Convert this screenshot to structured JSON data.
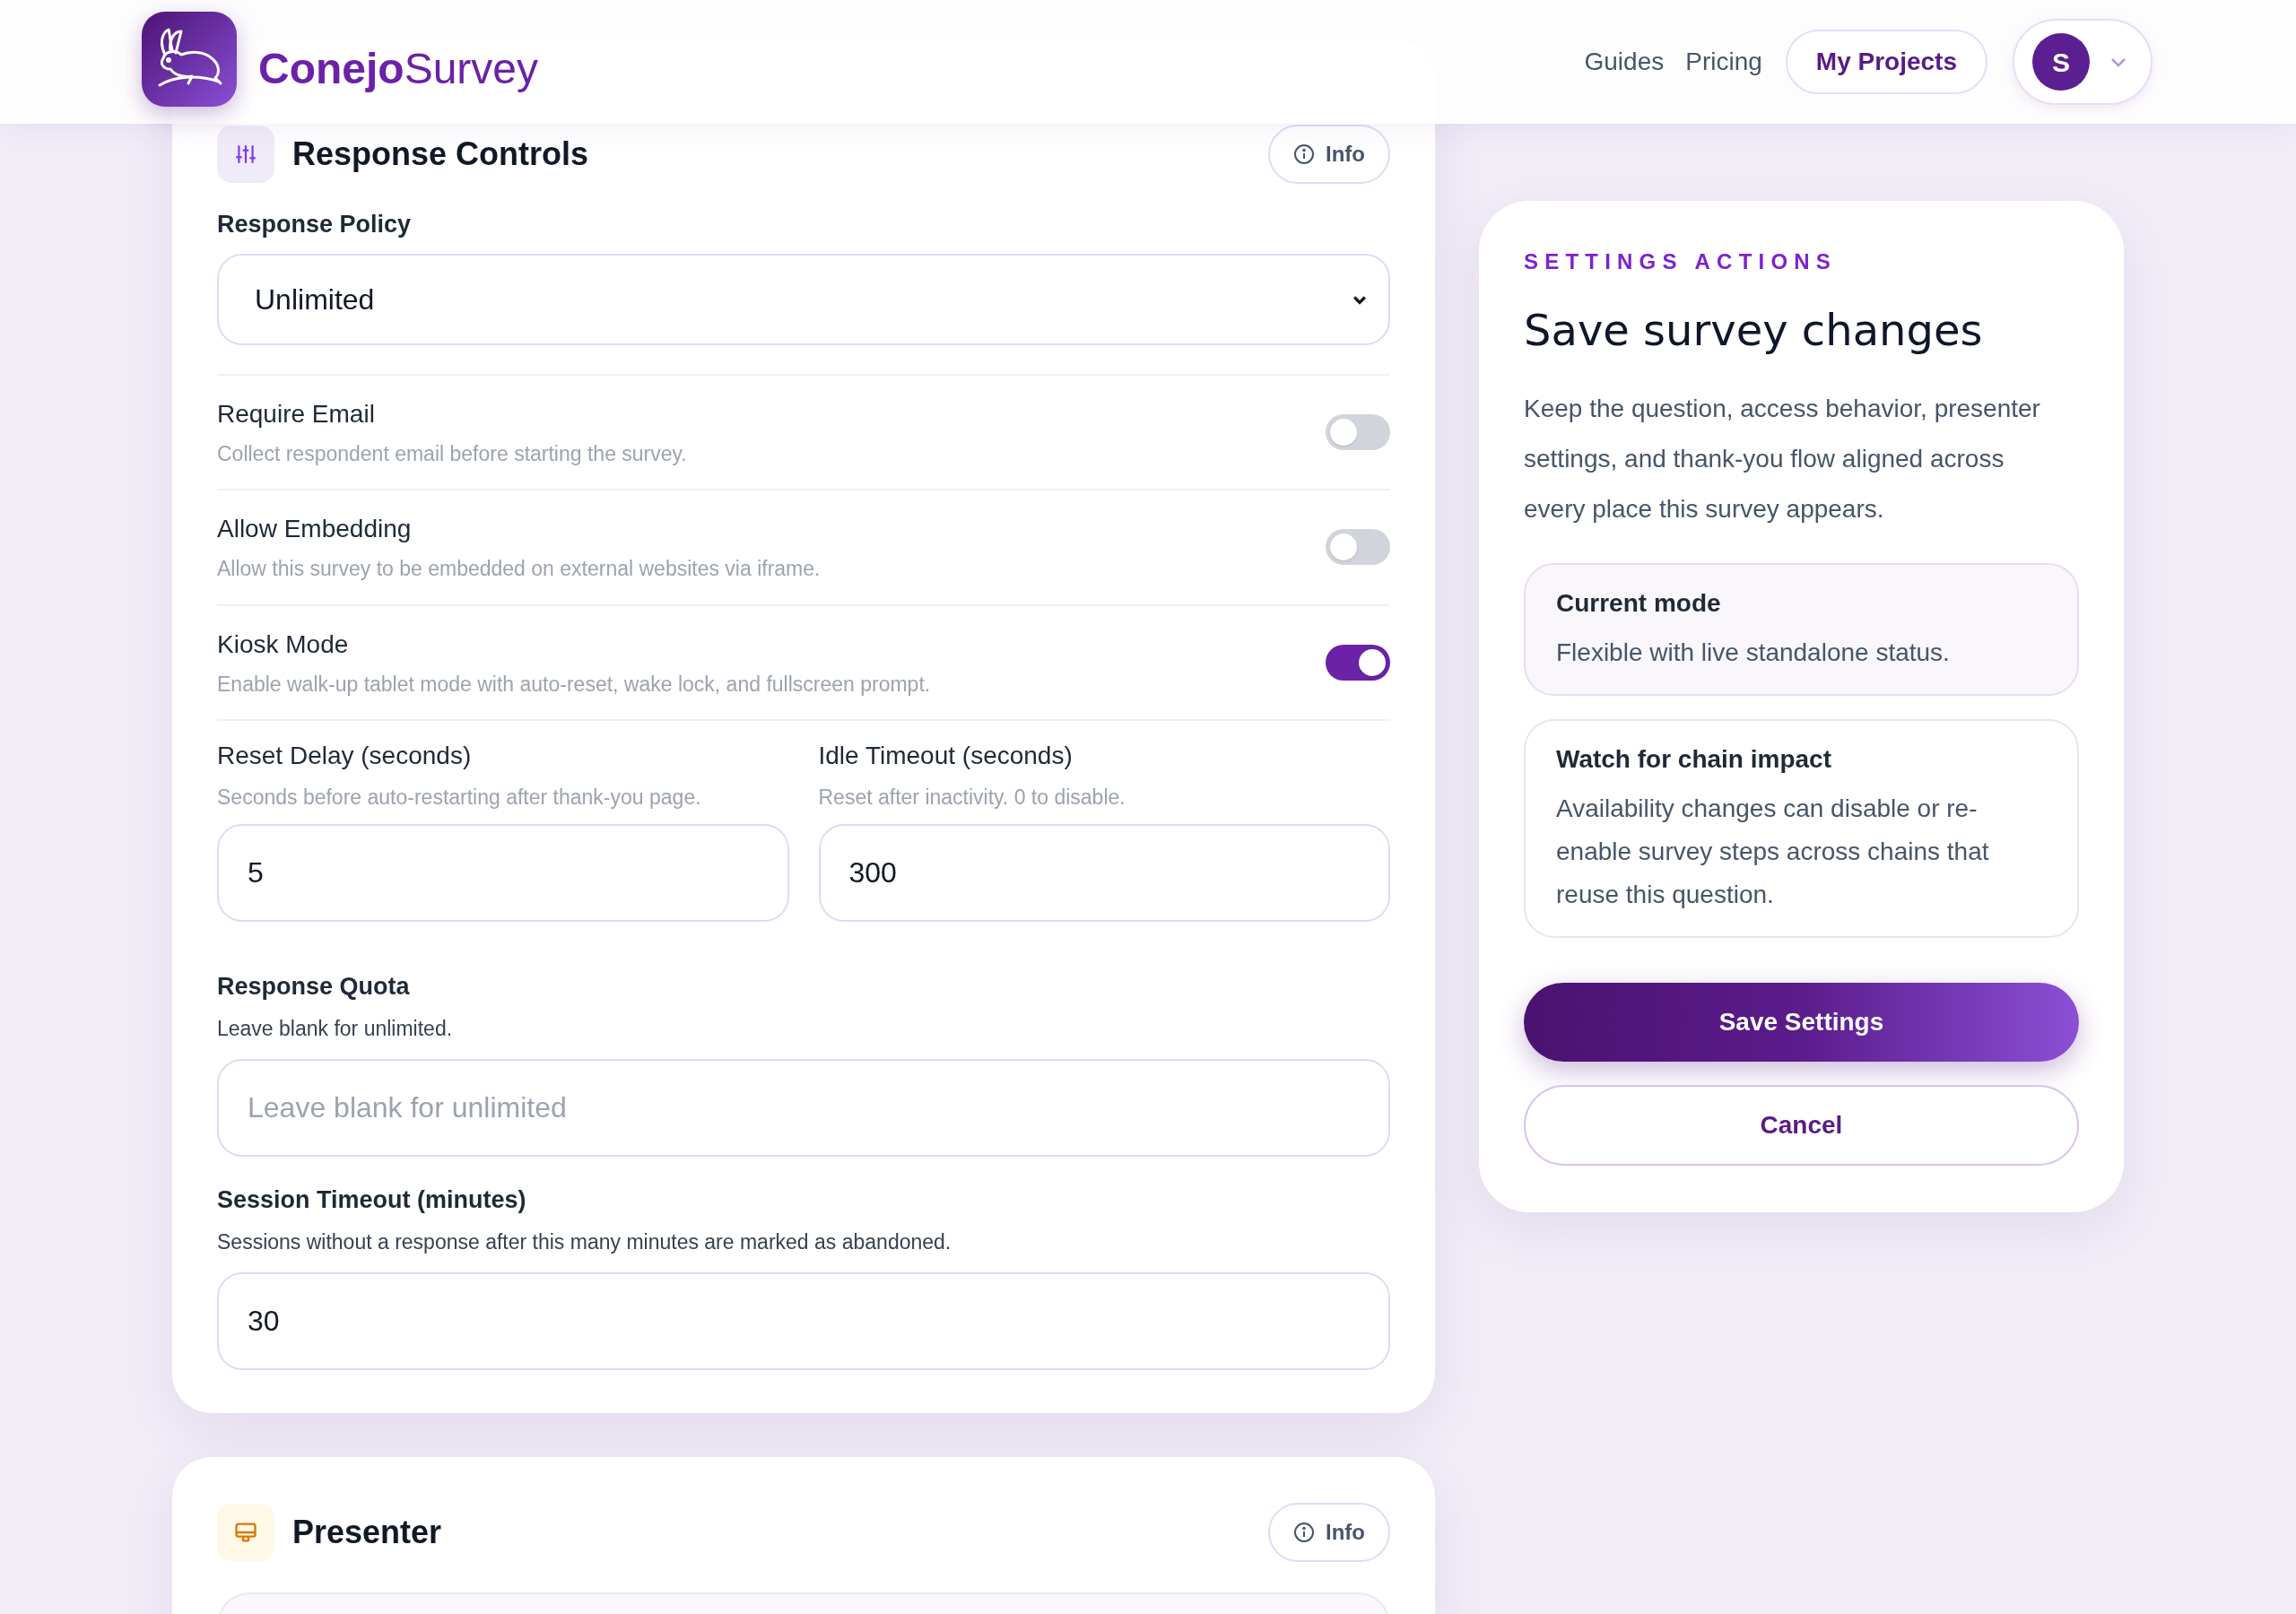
{
  "header": {
    "brand_bold": "Conejo",
    "brand_light": "Survey",
    "nav_links": [
      "Guides",
      "Pricing"
    ],
    "projects_button": "My Projects",
    "avatar_initial": "S"
  },
  "response_controls": {
    "title": "Response Controls",
    "info_button": "Info",
    "policy": {
      "label": "Response Policy",
      "value": "Unlimited"
    },
    "toggles": [
      {
        "label": "Require Email",
        "description": "Collect respondent email before starting the survey.",
        "on": false
      },
      {
        "label": "Allow Embedding",
        "description": "Allow this survey to be embedded on external websites via iframe.",
        "on": false
      },
      {
        "label": "Kiosk Mode",
        "description": "Enable walk-up tablet mode with auto-reset, wake lock, and fullscreen prompt.",
        "on": true
      }
    ],
    "reset_delay": {
      "label": "Reset Delay (seconds)",
      "description": "Seconds before auto-restarting after thank-you page.",
      "value": "5"
    },
    "idle_timeout": {
      "label": "Idle Timeout (seconds)",
      "description": "Reset after inactivity. 0 to disable.",
      "value": "300"
    },
    "response_quota": {
      "label": "Response Quota",
      "description": "Leave blank for unlimited.",
      "placeholder": "Leave blank for unlimited"
    },
    "session_timeout": {
      "label": "Session Timeout (minutes)",
      "description": "Sessions without a response after this many minutes are marked as abandoned.",
      "value": "30"
    }
  },
  "presenter": {
    "title": "Presenter",
    "info_button": "Info"
  },
  "settings_actions": {
    "eyebrow": "SETTINGS ACTIONS",
    "title": "Save survey changes",
    "description": "Keep the question, access behavior, presenter settings, and thank-you flow aligned across every place this survey appears.",
    "notes": [
      {
        "kind": "highlight",
        "title": "Current mode",
        "text": "Flexible with live standalone status."
      },
      {
        "kind": "plain",
        "title": "Watch for chain impact",
        "text": "Availability changes can disable or re-enable survey steps across chains that reuse this question."
      }
    ],
    "save_button": "Save Settings",
    "cancel_button": "Cancel"
  }
}
